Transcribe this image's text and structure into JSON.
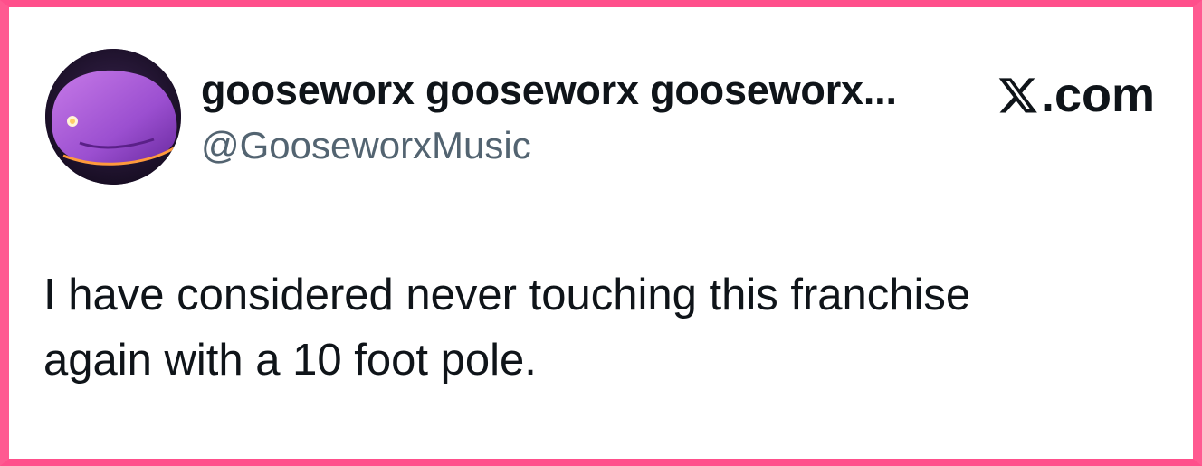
{
  "post": {
    "display_name": "gooseworx gooseworx gooseworx...",
    "handle": "@GooseworxMusic",
    "text": "I have considered never touching this franchise\nagain with a 10 foot pole.",
    "avatar_icon": "purple-creature-avatar"
  },
  "site": {
    "logo_icon": "x-logo-icon",
    "label": ".com"
  },
  "colors": {
    "frame_border": "#ff4f8b",
    "primary_text": "#0f1419",
    "secondary_text": "#536471",
    "background": "#ffffff"
  }
}
